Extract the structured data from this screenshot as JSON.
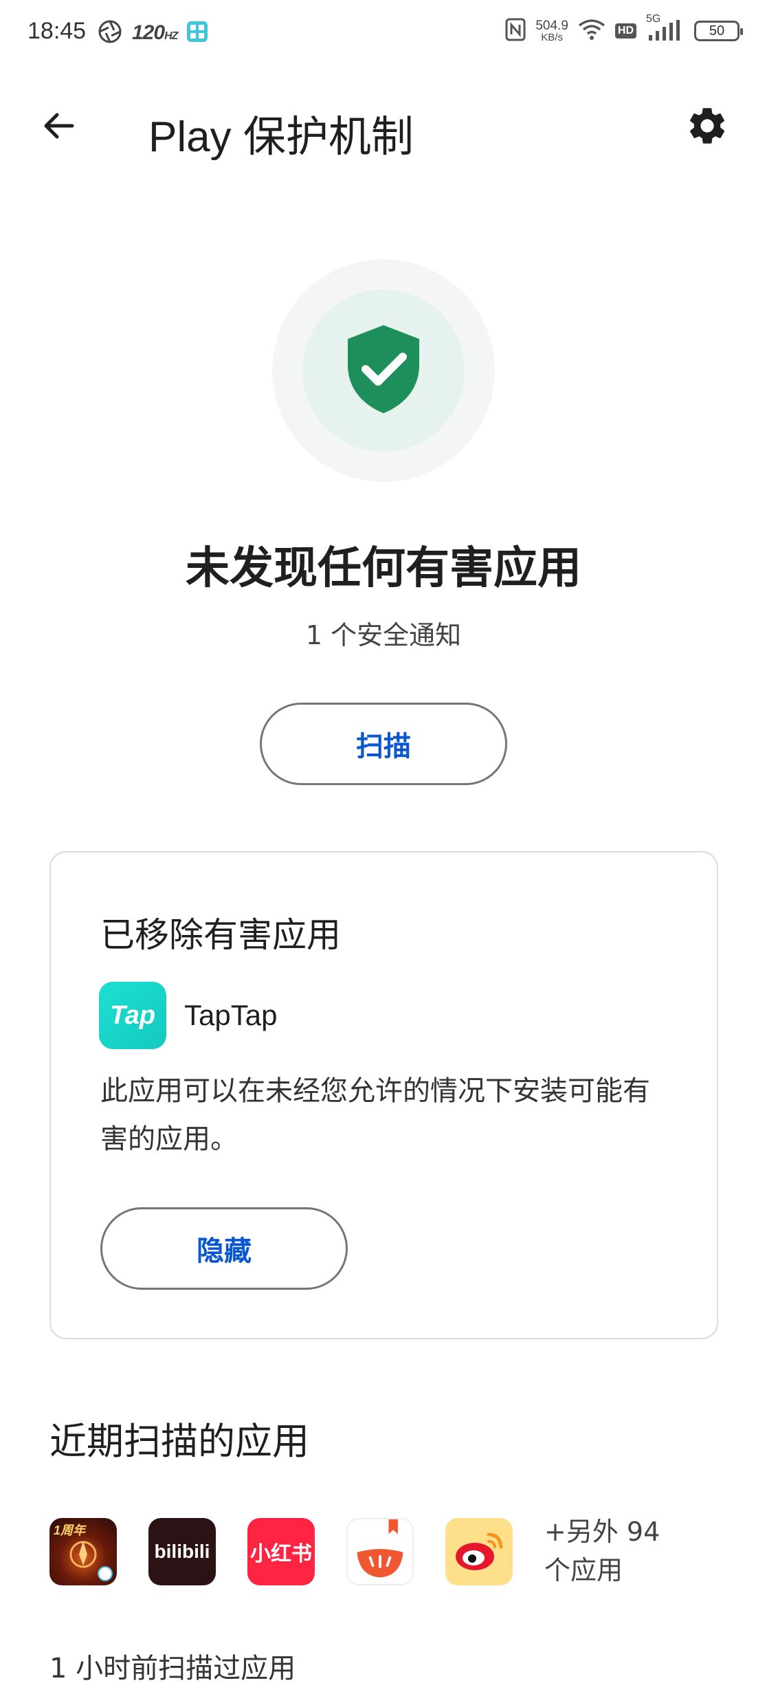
{
  "status_bar": {
    "time": "18:45",
    "hz_label": "120",
    "net_speed_value": "504.9",
    "net_speed_unit": "KB/s",
    "hd_label": "HD",
    "network_type": "5G",
    "battery_level": "50"
  },
  "app_bar": {
    "title": "Play 保护机制",
    "back_icon": "arrow-back-icon",
    "settings_icon": "gear-icon"
  },
  "protection": {
    "status_title": "未发现任何有害应用",
    "status_subtitle": "1 个安全通知",
    "scan_label": "扫描",
    "accent_color": "#1e8e5a"
  },
  "removed_card": {
    "title": "已移除有害应用",
    "app_icon_text": "Tap",
    "app_name": "TapTap",
    "description": "此应用可以在未经您允许的情况下安装可能有害的应用。",
    "hide_label": "隐藏"
  },
  "recent": {
    "title": "近期扫描的应用",
    "apps": [
      {
        "name": "game-app",
        "badge": "1周年"
      },
      {
        "name": "bilibili",
        "label": "bilibili"
      },
      {
        "name": "xiaohongshu",
        "label": "小红书"
      },
      {
        "name": "tomato-novel"
      },
      {
        "name": "weibo"
      }
    ],
    "more_text": "+另外 94 个应用",
    "last_scan": "1 小时前扫描过应用"
  }
}
